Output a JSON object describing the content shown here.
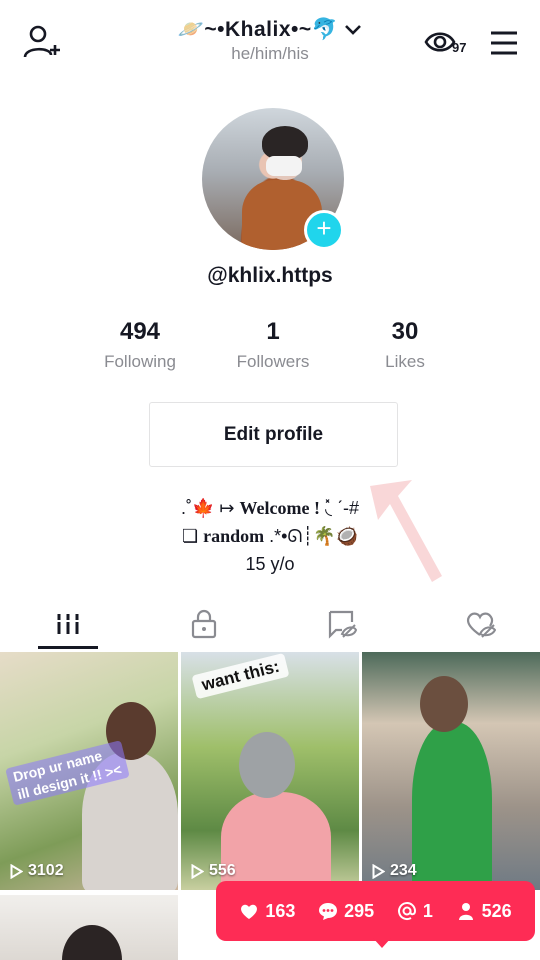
{
  "header": {
    "username": "🪐~•Khalix•~🐬",
    "pronouns": "he/him/his",
    "viewers_count": "97"
  },
  "profile": {
    "handle": "@khlix.https",
    "stats": [
      {
        "value": "494",
        "label": "Following"
      },
      {
        "value": "1",
        "label": "Followers"
      },
      {
        "value": "30",
        "label": "Likes"
      }
    ],
    "edit_label": "Edit profile",
    "bio": {
      "line1_prefix": ".˚🍁 ↦",
      "line1_bold": "Welcome !",
      "line1_suffix": "◟̽ ˊ-#",
      "line2_prefix": "❏",
      "line2_bold": "random",
      "line2_suffix": ".*•ᘏ┊🌴🥥",
      "line3": "15 y/o"
    }
  },
  "tabs": [
    "videos-grid",
    "private",
    "reposts",
    "liked"
  ],
  "videos": [
    {
      "views": "3102",
      "sticker": "Drop ur name\nill design it !! ><"
    },
    {
      "views": "556",
      "sticker": "want this:"
    },
    {
      "views": "234"
    }
  ],
  "notifications": {
    "likes": "163",
    "comments": "295",
    "mentions": "1",
    "followers": "526"
  },
  "colors": {
    "accent": "#fe2c55",
    "avatar_add": "#20d5ec",
    "muted_text": "#8a8b91"
  }
}
